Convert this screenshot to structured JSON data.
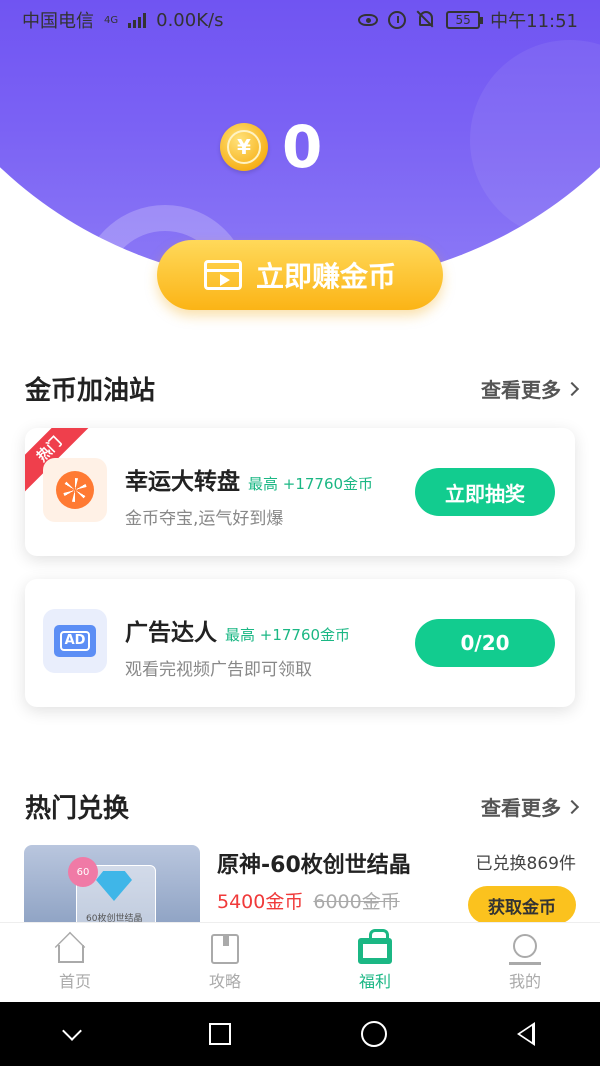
{
  "status_bar": {
    "carrier": "中国电信",
    "network": "4G",
    "speed": "0.00K/s",
    "battery": "55",
    "time": "中午11:51"
  },
  "hero": {
    "coin_symbol": "¥",
    "coin_count": "0",
    "earn_button": "立即赚金币"
  },
  "gas_station": {
    "title": "金币加油站",
    "more": "查看更多",
    "cards": [
      {
        "badge": "热门",
        "title": "幸运大转盘",
        "reward": "最高 +17760金币",
        "desc": "金币夺宝,运气好到爆",
        "button": "立即抽奖",
        "icon": "wheel-icon"
      },
      {
        "title": "广告达人",
        "reward": "最高 +17760金币",
        "desc": "观看完视频广告即可领取",
        "button": "0/20",
        "icon_text": "AD",
        "icon": "ad-tv-icon"
      }
    ]
  },
  "hot_exchange": {
    "title": "热门兑换",
    "more": "查看更多",
    "items": [
      {
        "name": "原神-60枚创世结晶",
        "price": "5400金币",
        "original_price": "6000金币",
        "sold": "已兑换869件",
        "button": "获取金币",
        "badge": "60",
        "caption": "60枚创世结晶"
      }
    ]
  },
  "tabbar": [
    {
      "label": "首页",
      "icon": "home-icon",
      "active": false
    },
    {
      "label": "攻略",
      "icon": "book-icon",
      "active": false
    },
    {
      "label": "福利",
      "icon": "gift-icon",
      "active": true
    },
    {
      "label": "我的",
      "icon": "profile-icon",
      "active": false
    }
  ],
  "colors": {
    "hero_purple": "#6a4df1",
    "accent_green": "#12cc8f",
    "gold": "#fbb416",
    "price_red": "#f03a3a"
  }
}
